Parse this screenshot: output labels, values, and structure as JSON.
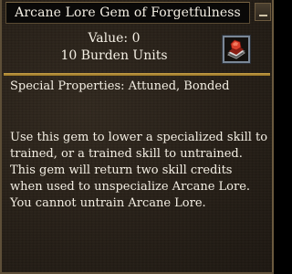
{
  "window": {
    "title": "Arcane Lore Gem of Forgetfulness"
  },
  "item": {
    "value_line": "Value: 0",
    "burden_line": "10 Burden Units",
    "icon": "arcane-gem-icon",
    "special_properties": "Special Properties: Attuned, Bonded",
    "description_lines": [
      "Use this gem to lower a specialized skill to",
      "trained, or a trained skill to untrained.",
      "This gem will return two skill credits",
      "when used to unspecialize Arcane Lore.",
      "You cannot untrain Arcane Lore."
    ]
  },
  "colors": {
    "panel_background": "#2a231b",
    "title_background": "#0a0908",
    "divider_gold": "#cfa64a",
    "text": "#f4efe4",
    "gem_red": "#c0392b"
  }
}
